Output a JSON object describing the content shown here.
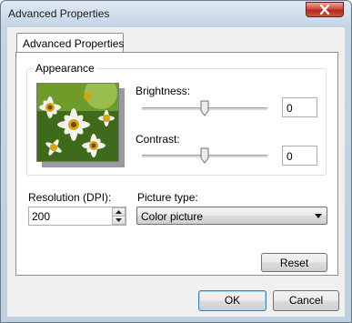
{
  "window": {
    "title": "Advanced Properties"
  },
  "tab": {
    "label": "Advanced Properties"
  },
  "appearance": {
    "group_label": "Appearance",
    "brightness_label": "Brightness:",
    "brightness_value": "0",
    "brightness_level": 0.5,
    "contrast_label": "Contrast:",
    "contrast_value": "0",
    "contrast_level": 0.5
  },
  "resolution": {
    "label": "Resolution (DPI):",
    "value": "200"
  },
  "picture_type": {
    "label": "Picture type:",
    "selected": "Color picture"
  },
  "buttons": {
    "reset": "Reset",
    "ok": "OK",
    "cancel": "Cancel"
  },
  "icons": [
    "close-icon",
    "spin-up-icon",
    "spin-down-icon",
    "dropdown-arrow-icon",
    "slider-thumb-icon"
  ]
}
